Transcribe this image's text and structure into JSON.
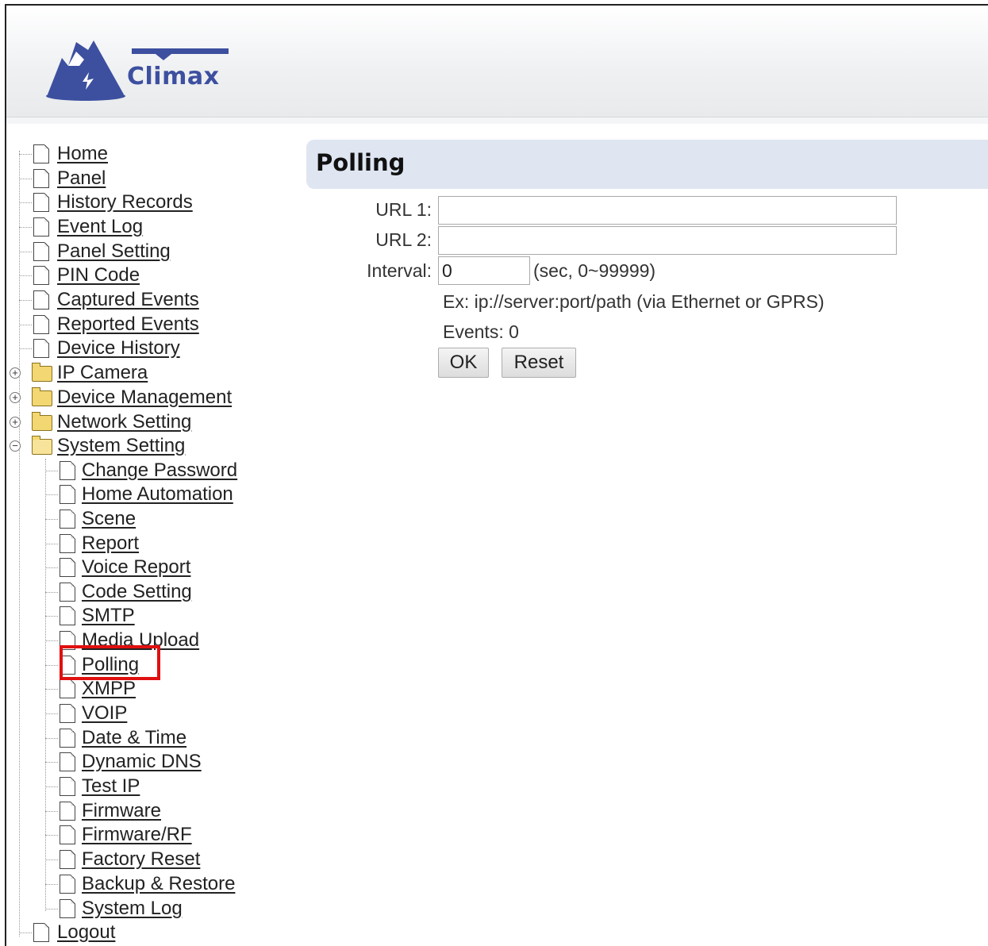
{
  "brand": {
    "name": "Climax"
  },
  "nav": {
    "home": "Home",
    "panel": "Panel",
    "history_records": "History Records",
    "event_log": "Event Log",
    "panel_setting": "Panel Setting",
    "pin_code": "PIN Code",
    "captured_events": "Captured Events",
    "reported_events": "Reported Events",
    "device_history": "Device History",
    "ip_camera": "IP Camera",
    "device_management": "Device Management",
    "network_setting": "Network Setting",
    "system_setting": "System Setting",
    "logout": "Logout",
    "system_children": {
      "change_password": "Change Password",
      "home_automation": "Home Automation",
      "scene": "Scene",
      "report": "Report",
      "voice_report": "Voice Report",
      "code_setting": "Code Setting",
      "smtp": "SMTP",
      "media_upload": "Media Upload",
      "polling": "Polling",
      "xmpp": "XMPP",
      "voip": "VOIP",
      "date_time": "Date & Time",
      "dynamic_dns": "Dynamic DNS",
      "test_ip": "Test IP",
      "firmware": "Firmware",
      "firmware_rf": "Firmware/RF",
      "factory_reset": "Factory Reset",
      "backup_restore": "Backup & Restore",
      "system_log": "System Log"
    },
    "expand_symbol": "+",
    "collapse_symbol": "−"
  },
  "page": {
    "title": "Polling",
    "url1_label": "URL 1:",
    "url1_value": "",
    "url2_label": "URL 2:",
    "url2_value": "",
    "interval_label": "Interval:",
    "interval_value": "0",
    "interval_hint": "(sec, 0~99999)",
    "example": "Ex: ip://server:port/path (via Ethernet or GPRS)",
    "events": "Events: 0",
    "ok_label": "OK",
    "reset_label": "Reset"
  },
  "colors": {
    "highlight": "#e01010",
    "title_bar": "#dfe6f2",
    "brand": "#3d4f9f"
  }
}
